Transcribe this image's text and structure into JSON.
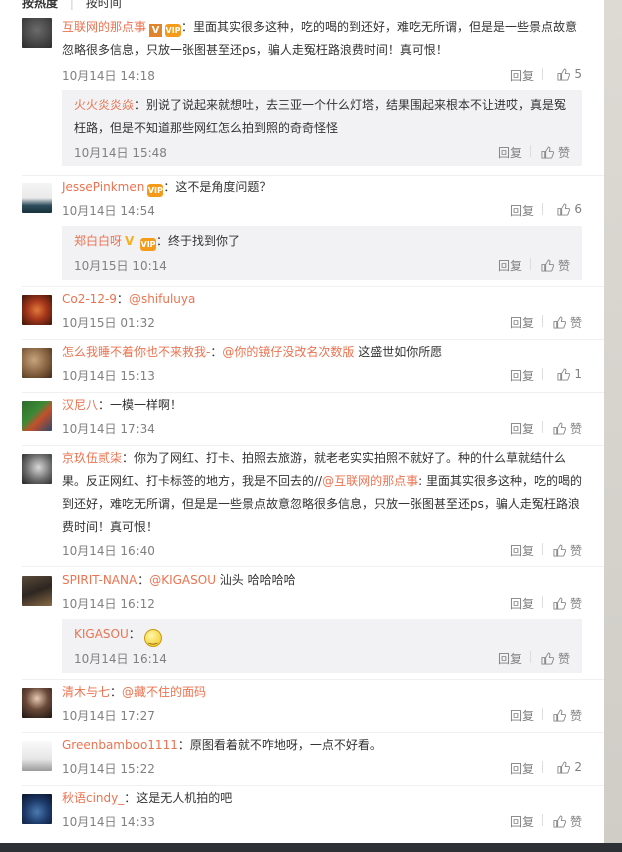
{
  "sort": {
    "hot": "按热度",
    "time": "按时间"
  },
  "reply_label": "回复",
  "like_label": "赞",
  "comments": [
    {
      "user": "互联网的那点事",
      "badges": [
        "V",
        "vip"
      ],
      "text": "：里面其实很多这种，吃的喝的到还好，难吃无所谓，但是是一些景点故意忽略很多信息，只放一张图甚至还ps，骗人走冤枉路浪费时间！真可恨！",
      "time": "10月14日 14:18",
      "likes": "5",
      "replies": [
        {
          "user": "火火炎炎焱",
          "text": "：别说了说起来就想吐，去三亚一个什么灯塔，结果围起来根本不让进哎，真是冤枉路，但是不知道那些网红怎么拍到照的奇奇怪怪",
          "time": "10月14日 15:48",
          "likes": "赞"
        }
      ]
    },
    {
      "user": "JessePinkmen",
      "badges": [
        "vip"
      ],
      "text": "：这不是角度问题？",
      "time": "10月14日 14:54",
      "likes": "6",
      "replies": [
        {
          "user": "郑白白呀",
          "badges": [
            "V-yellow",
            "vip"
          ],
          "text": "：终于找到你了",
          "time": "10月15日 10:14",
          "likes": "赞"
        }
      ]
    },
    {
      "user": "Co2-12-9",
      "text_parts": [
        "：",
        "@shifuluya"
      ],
      "time": "10月15日 01:32",
      "likes": "赞"
    },
    {
      "user": "怎么我睡不着你也不来救我-",
      "text_parts": [
        "：",
        "@你的镜仔没改名次数版",
        " 这盛世如你所愿"
      ],
      "time": "10月14日 15:13",
      "likes": "1"
    },
    {
      "user": "汉尼八",
      "text": "：一模一样啊！",
      "time": "10月14日 17:34",
      "likes": "赞"
    },
    {
      "user": "京玖伍贰柒",
      "text_parts": [
        "：你为了网红、打卡、拍照去旅游，就老老实实拍照不就好了。种的什么草就结什么果。反正网红、打卡标签的地方，我是不回去的//",
        "@互联网的那点事",
        ": 里面其实很多这种，吃的喝的到还好，难吃无所谓，但是是一些景点故意忽略很多信息，只放一张图甚至还ps，骗人走冤枉路浪费时间！真可恨！"
      ],
      "time": "10月14日 16:40",
      "likes": "赞"
    },
    {
      "user": "SPIRIT-NANA",
      "text_parts": [
        "：",
        "@KIGASOU",
        " 汕头 哈哈哈哈"
      ],
      "time": "10月14日 16:12",
      "likes": "赞",
      "replies": [
        {
          "user": "KIGASOU",
          "text": "：",
          "emoji": "smile-emoji",
          "time": "10月14日 16:14",
          "likes": "赞"
        }
      ]
    },
    {
      "user": "清木与七",
      "text_parts": [
        "：",
        "@藏不住的面码"
      ],
      "time": "10月14日 17:27",
      "likes": "赞"
    },
    {
      "user": "Greenbamboo1111",
      "text": "：原图看着就不咋地呀，一点不好看。",
      "time": "10月14日 15:22",
      "likes": "2"
    },
    {
      "user": "秋语cindy_",
      "text": "：这是无人机拍的吧",
      "time": "10月14日 14:33",
      "likes": "赞"
    }
  ]
}
